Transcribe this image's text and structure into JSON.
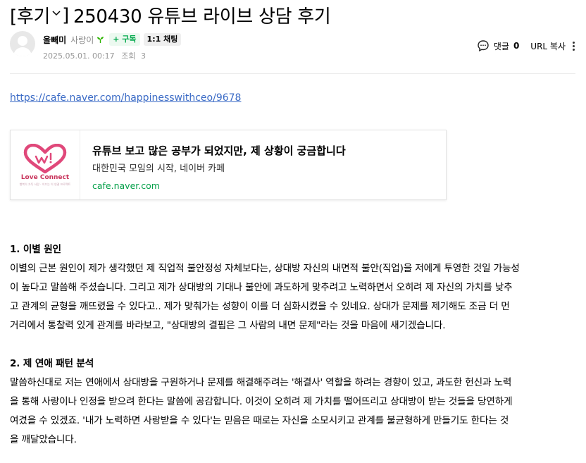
{
  "header": {
    "category": "[후기",
    "category_close": "]",
    "title": "250430 유튜브 라이브 상담 후기"
  },
  "author": {
    "nickname": "올빼미",
    "level": "사랑이",
    "subscribe_label": "+ 구독",
    "chat_label": "1:1 채팅"
  },
  "meta": {
    "datetime": "2025.05.01. 00:17",
    "views_label": "조회",
    "views_count": "3"
  },
  "tools": {
    "comment_label": "댓글",
    "comment_count": "0",
    "url_copy_label": "URL 복사"
  },
  "body_link": "https://cafe.naver.com/happinesswithceo/9678",
  "og_card": {
    "logo_text": "Love Connect",
    "logo_subtext": "행복이 가득 사랑 · 이끄는 이 연결 프로젝트",
    "title": "유튜브 보고 많은 공부가 되었지만, 제 상황이 궁금합니다",
    "description": "대한민국 모임의 시작, 네이버 카페",
    "domain": "cafe.naver.com"
  },
  "sections": [
    {
      "title": "1. 이별 원인",
      "lines": [
        "이별의 근본 원인이 제가 생각했던 제 직업적 불안정성 자체보다는, 상대방 자신의 내면적 불안(직업)을 저에게 투영한 것일 가능성",
        "이 높다고 말씀해 주셨습니다. 그리고 제가 상대방의 기대나 불안에 과도하게 맞추려고 노력하면서 오히려 제 자신의 가치를 낮추",
        "고 관계의 균형을 깨뜨렸을 수 있다고.. 제가 맞춰가는 성향이 이를 더 심화시켰을 수 있네요. 상대가 문제를 제기해도 조금 더 먼",
        "거리에서 통찰력 있게 관계를 바라보고, \"상대방의 결핍은 그 사람의 내면 문제\"라는 것을 마음에 새기겠습니다."
      ]
    },
    {
      "title": "2. 제 연애 패턴 분석",
      "lines": [
        "말씀하신대로 저는 연애에서 상대방을 구원하거나 문제를 해결해주려는 '해결사' 역할을 하려는 경향이 있고, 과도한 헌신과 노력",
        "을 통해 사랑이나 인정을 받으려 한다는 말씀에 공감합니다. 이것이 오히려 제 가치를 떨어뜨리고 상대방이 받는 것들을 당연하게",
        "여겼을 수 있겠죠. '내가 노력하면 사랑받을 수 있다'는 믿음은 때로는 자신을 소모시키고 관계를 불균형하게 만들기도 한다는 것",
        "을 깨달았습니다."
      ]
    }
  ],
  "colors": {
    "link": "#3b6bc6",
    "domain_green": "#06a04a",
    "subscribe_green": "#03a94d",
    "logo_pink": "#c8325a",
    "meta_gray": "#979797"
  }
}
